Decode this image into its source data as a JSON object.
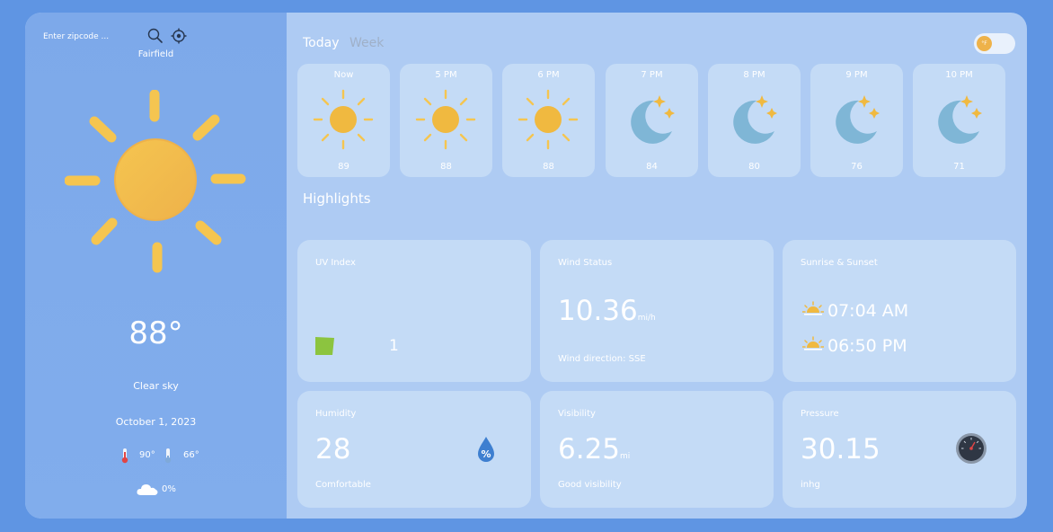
{
  "search": {
    "placeholder": "Enter zipcode ..."
  },
  "location": {
    "city": "Fairfield"
  },
  "current": {
    "temperature": "88°",
    "description": "Clear sky",
    "date": "October 1, 2023",
    "high": "90°",
    "low": "66°",
    "cloud_cover": "0%"
  },
  "tabs": {
    "today": "Today",
    "week": "Week"
  },
  "unit_toggle": {
    "label": "°F"
  },
  "hourly": [
    {
      "label": "Now",
      "temp": "89",
      "icon": "sun-icon"
    },
    {
      "label": "5 PM",
      "temp": "88",
      "icon": "sun-icon"
    },
    {
      "label": "6 PM",
      "temp": "88",
      "icon": "sun-icon"
    },
    {
      "label": "7 PM",
      "temp": "84",
      "icon": "moon-stars-icon"
    },
    {
      "label": "8 PM",
      "temp": "80",
      "icon": "moon-stars-icon"
    },
    {
      "label": "9 PM",
      "temp": "76",
      "icon": "moon-stars-icon"
    },
    {
      "label": "10 PM",
      "temp": "71",
      "icon": "moon-stars-icon"
    }
  ],
  "highlights": {
    "title": "Highlights",
    "uv": {
      "title": "UV Index",
      "value": "1"
    },
    "wind": {
      "title": "Wind Status",
      "value": "10.36",
      "unit": "mi/h",
      "direction": "Wind direction: SSE"
    },
    "sun": {
      "title": "Sunrise & Sunset",
      "sunrise": "07:04 AM",
      "sunset": "06:50 PM"
    },
    "humidity": {
      "title": "Humidity",
      "value": "28",
      "note": "Comfortable",
      "badge": "%"
    },
    "visibility": {
      "title": "Visibility",
      "value": "6.25",
      "unit": "mi",
      "note": "Good visibility"
    },
    "pressure": {
      "title": "Pressure",
      "value": "30.15",
      "unit": "inhg"
    }
  },
  "colors": {
    "background": "#5f95e3",
    "sidebar": "#7da9ea",
    "main": "#aecbf3",
    "card": "#c4dbf6",
    "sun": "#f0b940",
    "uv_low": "#8cc43f"
  }
}
